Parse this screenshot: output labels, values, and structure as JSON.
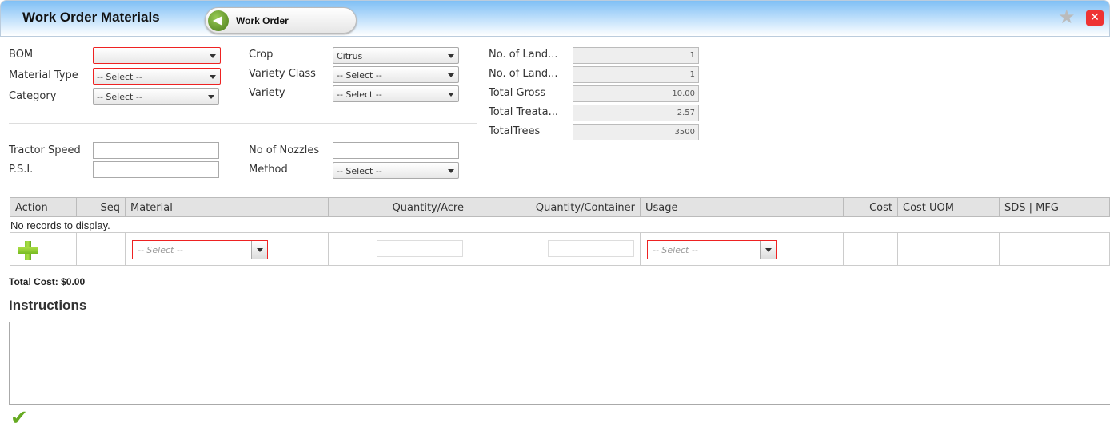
{
  "header": {
    "title": "Work Order Materials",
    "back_label": "Work Order"
  },
  "form": {
    "bom": {
      "label": "BOM",
      "value": ""
    },
    "material_type": {
      "label": "Material Type",
      "value": "-- Select --"
    },
    "category": {
      "label": "Category",
      "value": "-- Select --"
    },
    "crop": {
      "label": "Crop",
      "value": "Citrus"
    },
    "variety_class": {
      "label": "Variety Class",
      "value": "-- Select --"
    },
    "variety": {
      "label": "Variety",
      "value": "-- Select --"
    },
    "land1": {
      "label": "No. of Land...",
      "value": "1"
    },
    "land2": {
      "label": "No. of Land...",
      "value": "1"
    },
    "total_gross": {
      "label": "Total Gross",
      "value": "10.00"
    },
    "total_treated": {
      "label": "Total Treata...",
      "value": "2.57"
    },
    "total_trees": {
      "label": "TotalTrees",
      "value": "3500"
    },
    "tractor_speed": {
      "label": "Tractor Speed",
      "value": ""
    },
    "psi": {
      "label": "P.S.I.",
      "value": ""
    },
    "nozzles": {
      "label": "No of Nozzles",
      "value": ""
    },
    "method": {
      "label": "Method",
      "value": "-- Select --"
    }
  },
  "grid": {
    "columns": [
      "Action",
      "Seq",
      "Material",
      "Quantity/Acre",
      "Quantity/Container",
      "Usage",
      "Cost",
      "Cost UOM",
      "SDS | MFG"
    ],
    "empty_text": "No records to display.",
    "material_placeholder": "-- Select --",
    "usage_placeholder": "-- Select --"
  },
  "total_cost": "Total Cost: $0.00",
  "instructions": {
    "label": "Instructions",
    "value": ""
  },
  "colors": {
    "required": "#ee2222",
    "accent": "#7fbff5"
  }
}
